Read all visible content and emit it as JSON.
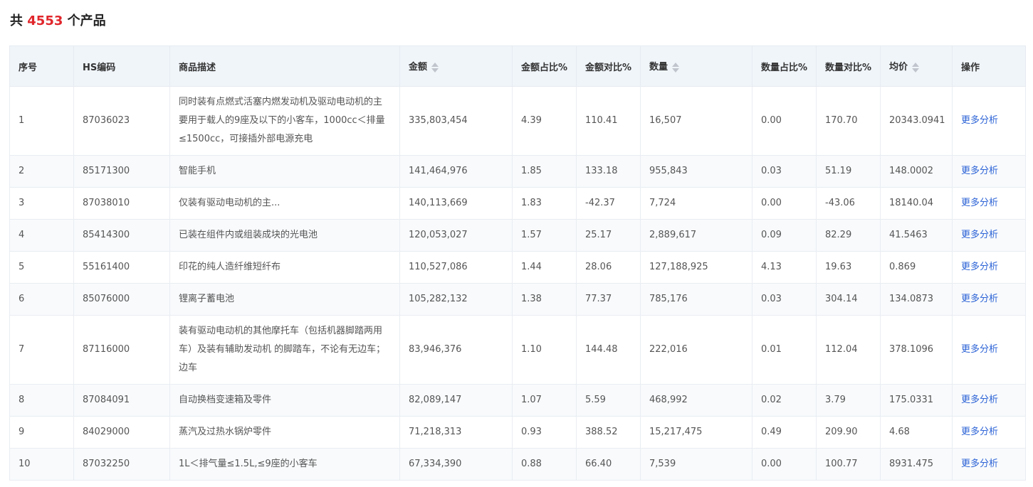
{
  "summary": {
    "prefix": "共",
    "count": "4553",
    "suffix": "个产品"
  },
  "colors": {
    "accent_count": "#e0262b",
    "link": "#2c63d6",
    "header_bg": "#f0f5fa",
    "stripe_bg": "#f8fafc"
  },
  "table": {
    "columns": [
      {
        "label": "序号",
        "sortable": false
      },
      {
        "label": "HS编码",
        "sortable": false
      },
      {
        "label": "商品描述",
        "sortable": false
      },
      {
        "label": "金额",
        "sortable": true
      },
      {
        "label": "金额占比%",
        "sortable": false
      },
      {
        "label": "金额对比%",
        "sortable": false
      },
      {
        "label": "数量",
        "sortable": true
      },
      {
        "label": "数量占比%",
        "sortable": false
      },
      {
        "label": "数量对比%",
        "sortable": false
      },
      {
        "label": "均价",
        "sortable": true
      },
      {
        "label": "操作",
        "sortable": false
      }
    ],
    "rows": [
      {
        "no": "1",
        "hs": "87036023",
        "desc": "同时装有点燃式活塞内燃发动机及驱动电动机的主要用于载人的9座及以下的小客车，1000cc＜排量≤1500cc，可接插外部电源充电",
        "amount": "335,803,454",
        "amount_share": "4.39",
        "amount_cmp": "110.41",
        "qty": "16,507",
        "qty_share": "0.00",
        "qty_cmp": "170.70",
        "avg_price": "20343.0941",
        "action": "更多分析"
      },
      {
        "no": "2",
        "hs": "85171300",
        "desc": "智能手机",
        "amount": "141,464,976",
        "amount_share": "1.85",
        "amount_cmp": "133.18",
        "qty": "955,843",
        "qty_share": "0.03",
        "qty_cmp": "51.19",
        "avg_price": "148.0002",
        "action": "更多分析"
      },
      {
        "no": "3",
        "hs": "87038010",
        "desc": "仅装有驱动电动机的主...",
        "amount": "140,113,669",
        "amount_share": "1.83",
        "amount_cmp": "-42.37",
        "qty": "7,724",
        "qty_share": "0.00",
        "qty_cmp": "-43.06",
        "avg_price": "18140.04",
        "action": "更多分析"
      },
      {
        "no": "4",
        "hs": "85414300",
        "desc": "已装在组件内或组装成块的光电池",
        "amount": "120,053,027",
        "amount_share": "1.57",
        "amount_cmp": "25.17",
        "qty": "2,889,617",
        "qty_share": "0.09",
        "qty_cmp": "82.29",
        "avg_price": "41.5463",
        "action": "更多分析"
      },
      {
        "no": "5",
        "hs": "55161400",
        "desc": "印花的纯人造纤维短纤布",
        "amount": "110,527,086",
        "amount_share": "1.44",
        "amount_cmp": "28.06",
        "qty": "127,188,925",
        "qty_share": "4.13",
        "qty_cmp": "19.63",
        "avg_price": "0.869",
        "action": "更多分析"
      },
      {
        "no": "6",
        "hs": "85076000",
        "desc": "锂离子蓄电池",
        "amount": "105,282,132",
        "amount_share": "1.38",
        "amount_cmp": "77.37",
        "qty": "785,176",
        "qty_share": "0.03",
        "qty_cmp": "304.14",
        "avg_price": "134.0873",
        "action": "更多分析"
      },
      {
        "no": "7",
        "hs": "87116000",
        "desc": "装有驱动电动机的其他摩托车（包括机器脚踏两用车）及装有辅助发动机 的脚踏车，不论有无边车；边车",
        "amount": "83,946,376",
        "amount_share": "1.10",
        "amount_cmp": "144.48",
        "qty": "222,016",
        "qty_share": "0.01",
        "qty_cmp": "112.04",
        "avg_price": "378.1096",
        "action": "更多分析"
      },
      {
        "no": "8",
        "hs": "87084091",
        "desc": "自动换档变速箱及零件",
        "amount": "82,089,147",
        "amount_share": "1.07",
        "amount_cmp": "5.59",
        "qty": "468,992",
        "qty_share": "0.02",
        "qty_cmp": "3.79",
        "avg_price": "175.0331",
        "action": "更多分析"
      },
      {
        "no": "9",
        "hs": "84029000",
        "desc": "蒸汽及过热水锅炉零件",
        "amount": "71,218,313",
        "amount_share": "0.93",
        "amount_cmp": "388.52",
        "qty": "15,217,475",
        "qty_share": "0.49",
        "qty_cmp": "209.90",
        "avg_price": "4.68",
        "action": "更多分析"
      },
      {
        "no": "10",
        "hs": "87032250",
        "desc": "1L＜排气量≤1.5L,≤9座的小客车",
        "amount": "67,334,390",
        "amount_share": "0.88",
        "amount_cmp": "66.40",
        "qty": "7,539",
        "qty_share": "0.00",
        "qty_cmp": "100.77",
        "avg_price": "8931.475",
        "action": "更多分析"
      }
    ]
  }
}
